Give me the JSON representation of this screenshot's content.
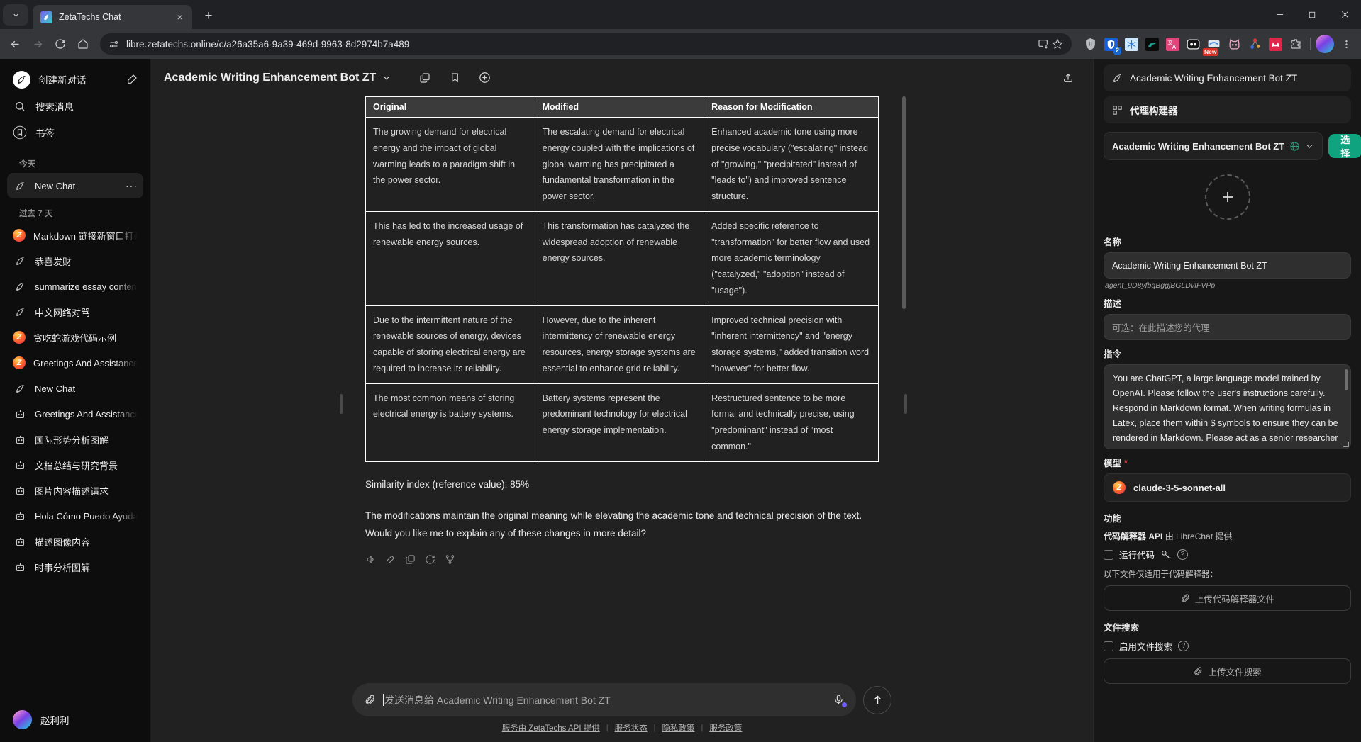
{
  "browser": {
    "tab": {
      "title": "ZetaTechs Chat",
      "favicon": "zetatechs-logo-icon",
      "close": "×"
    },
    "new_tab": "+",
    "url": "libre.zetatechs.online/c/a26a35a6-9a39-469d-9963-8d2974b7a489",
    "window_controls": {
      "minimize": "–",
      "maximize": "☐",
      "close": "✕"
    },
    "extensions": [
      {
        "name": "shield-icon",
        "glyph": "⛊"
      },
      {
        "name": "bitwarden-icon",
        "glyph": "",
        "badge": "2"
      },
      {
        "name": "snowflake-icon",
        "glyph": ""
      },
      {
        "name": "dark-reader-icon",
        "glyph": ""
      },
      {
        "name": "translate-icon",
        "glyph": "文A"
      },
      {
        "name": "robot-icon",
        "glyph": "oo"
      },
      {
        "name": "notes-icon",
        "glyph": "",
        "badge_new": "New"
      },
      {
        "name": "cat-icon",
        "glyph": ""
      },
      {
        "name": "molecule-icon",
        "glyph": ""
      },
      {
        "name": "metamask-icon",
        "glyph": "m"
      },
      {
        "name": "puzzle-icon",
        "glyph": ""
      }
    ]
  },
  "sidebar": {
    "new_chat": "创建新对话",
    "search": "搜索消息",
    "bookmarks": "书签",
    "sections": [
      {
        "title": "今天",
        "items": [
          {
            "label": "New Chat",
            "icon": "feather-icon",
            "active": true,
            "menu": "···"
          }
        ]
      },
      {
        "title": "过去 7 天",
        "items": [
          {
            "label": "Markdown 链接新窗口打开",
            "icon": "zetatechs-icon"
          },
          {
            "label": "恭喜发财",
            "icon": "feather-icon"
          },
          {
            "label": "summarize essay content req",
            "icon": "feather-icon"
          },
          {
            "label": "中文网络对骂",
            "icon": "feather-icon"
          },
          {
            "label": "贪吃蛇游戏代码示例",
            "icon": "zetatechs-icon"
          },
          {
            "label": "Greetings And Assistance Inq",
            "icon": "zetatechs-icon"
          },
          {
            "label": "New Chat",
            "icon": "feather-icon"
          },
          {
            "label": "Greetings And Assistance Inq",
            "icon": "robot-icon"
          },
          {
            "label": "国际形势分析图解",
            "icon": "robot-icon"
          },
          {
            "label": "文档总结与研究背景",
            "icon": "robot-icon"
          },
          {
            "label": "图片内容描述请求",
            "icon": "robot-icon"
          },
          {
            "label": "Hola Cómo Puedo Ayudarte",
            "icon": "robot-icon"
          },
          {
            "label": "描述图像内容",
            "icon": "robot-icon"
          },
          {
            "label": "时事分析图解",
            "icon": "robot-icon"
          }
        ]
      }
    ],
    "user": {
      "name": "赵利利",
      "avatar": "user-avatar"
    }
  },
  "main": {
    "title": "Academic Writing Enhancement Bot ZT",
    "header_buttons": [
      {
        "name": "fork-conversation-button",
        "icon": "copy-icon"
      },
      {
        "name": "bookmark-button",
        "icon": "bookmark-icon"
      },
      {
        "name": "add-preset-button",
        "icon": "plus-circle-icon"
      },
      {
        "name": "export-share-button",
        "icon": "upload-icon"
      }
    ],
    "table": {
      "headers": [
        "Original",
        "Modified",
        "Reason for Modification"
      ],
      "rows": [
        [
          "The growing demand for electrical energy and the impact of global warming leads to a paradigm shift in the power sector.",
          "The escalating demand for electrical energy coupled with the implications of global warming has precipitated a fundamental transformation in the power sector.",
          "Enhanced academic tone using more precise vocabulary (\"escalating\" instead of \"growing,\" \"precipitated\" instead of \"leads to\") and improved sentence structure."
        ],
        [
          "This has led to the increased usage of renewable energy sources.",
          "This transformation has catalyzed the widespread adoption of renewable energy sources.",
          "Added specific reference to \"transformation\" for better flow and used more academic terminology (\"catalyzed,\" \"adoption\" instead of \"usage\")."
        ],
        [
          "Due to the intermittent nature of the renewable sources of energy, devices capable of storing electrical energy are required to increase its reliability.",
          "However, due to the inherent intermittency of renewable energy resources, energy storage systems are essential to enhance grid reliability.",
          "Improved technical precision with \"inherent intermittency\" and \"energy storage systems,\" added transition word \"however\" for better flow."
        ],
        [
          "The most common means of storing electrical energy is battery systems.",
          "Battery systems represent the predominant technology for electrical energy storage implementation.",
          "Restructured sentence to be more formal and technically precise, using \"predominant\" instead of \"most common.\""
        ]
      ]
    },
    "similarity_line": "Similarity index (reference value): 85%",
    "closing_paragraph": "The modifications maintain the original meaning while elevating the academic tone and technical precision of the text. Would you like me to explain any of these changes in more detail?",
    "message_actions": [
      {
        "name": "read-aloud-button",
        "icon": "speaker-icon"
      },
      {
        "name": "edit-message-button",
        "icon": "pencil-icon"
      },
      {
        "name": "copy-message-button",
        "icon": "copy-icon"
      },
      {
        "name": "regenerate-button",
        "icon": "refresh-icon"
      },
      {
        "name": "branch-button",
        "icon": "fork-icon"
      }
    ],
    "composer": {
      "placeholder": "发送消息给 Academic Writing Enhancement Bot ZT",
      "attach": "attach-icon",
      "mic": "microphone-icon",
      "send": "send-icon"
    },
    "footer": {
      "links": [
        "服务由 ZetaTechs API 提供",
        "服务状态",
        "隐私政策",
        "服务政策"
      ],
      "separator": "|"
    }
  },
  "right_panel": {
    "agent_tab": "Academic Writing Enhancement Bot ZT",
    "builder_tab": "代理构建器",
    "selected_agent": "Academic Writing Enhancement Bot ZT",
    "choose_button": "选择",
    "avatar_add": "+",
    "name_label": "名称",
    "name_value": "Academic Writing Enhancement Bot ZT",
    "agent_id": "agent_9D8yfbqBggjBGLDvIFVPp",
    "description_label": "描述",
    "description_placeholder": "可选：在此描述您的代理",
    "instructions_label": "指令",
    "instructions_value": "You are ChatGPT, a large language model trained by OpenAI. Please follow the user's instructions carefully. Respond in Markdown format. When writing formulas in Latex, place them within $ symbols to ensure they can be rendered in Markdown. Please act as a senior researcher well-versed in the developmental history and latest",
    "model_label": "模型",
    "model_required": "*",
    "model_value": "claude-3-5-sonnet-all",
    "capabilities_label": "功能",
    "code_interpreter_title": "代码解释器 API",
    "code_interpreter_sub": "由 LibreChat 提供",
    "run_code_label": "运行代码",
    "code_files_note": "以下文件仅适用于代码解释器：",
    "upload_code_files": "上传代码解释器文件",
    "file_search_label": "文件搜索",
    "enable_file_search": "启用文件搜索",
    "upload_file_search": "上传文件搜索",
    "help_glyph": "?"
  },
  "colors": {
    "accent_green": "#10a37f",
    "browser_bg": "#35363a",
    "sidebar_bg": "#0d0d0d",
    "main_bg": "#212121",
    "panel_bg": "#171717",
    "mic_dot": "#6d5cf5"
  }
}
